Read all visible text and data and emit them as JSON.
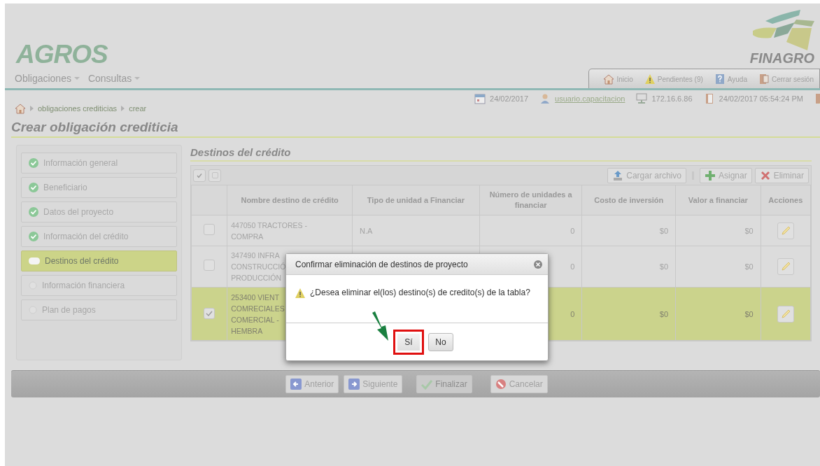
{
  "header": {
    "logo": "AGROS",
    "brand": "FINAGRO",
    "menu": [
      {
        "label": "Obligaciones"
      },
      {
        "label": "Consultas"
      }
    ],
    "top_links": [
      {
        "kind": "home",
        "label": "Inicio"
      },
      {
        "kind": "warning",
        "label": "Pendientes (9)"
      },
      {
        "kind": "help",
        "label": "Ayuda"
      },
      {
        "kind": "exit",
        "label": "Cerrar sesión"
      }
    ]
  },
  "info_bar": [
    {
      "kind": "date",
      "text": "24/02/2017"
    },
    {
      "kind": "user",
      "text": "usuario.capacitacion"
    },
    {
      "kind": "ip",
      "text": "172.16.6.86"
    },
    {
      "kind": "session",
      "text": "24/02/2017 05:54:24 PM"
    },
    {
      "kind": "alert"
    }
  ],
  "breadcrumb": [
    "obligaciones crediticias",
    "crear"
  ],
  "page_title": "Crear obligación crediticia",
  "steps": [
    {
      "label": "Información general",
      "kind": "done",
      "selected": false
    },
    {
      "label": "Beneficiario",
      "kind": "done",
      "selected": false
    },
    {
      "label": "Datos del proyecto",
      "kind": "done",
      "selected": false
    },
    {
      "label": "Información del crédito",
      "kind": "done",
      "selected": false
    },
    {
      "label": "Destinos del crédito",
      "kind": "current",
      "selected": true
    },
    {
      "label": "Información financiera",
      "kind": "pending",
      "selected": false
    },
    {
      "label": "Plan de pagos",
      "kind": "pending",
      "selected": false
    }
  ],
  "section_title": "Destinos del crédito",
  "toolbar_checks": [
    {
      "checked": true
    },
    {
      "checked": false
    }
  ],
  "toolbar": [
    {
      "kind": "upload",
      "label": "Cargar archivo"
    },
    {
      "kind": "add",
      "label": "Asignar"
    },
    {
      "kind": "delete",
      "label": "Eliminar"
    }
  ],
  "table": {
    "columns": [
      "Nombre destino de crédito",
      "Tipo de unidad a Financiar",
      "Número de unidades a financiar",
      "Costo de inversión",
      "Valor a financiar",
      "Acciones"
    ],
    "rows": [
      {
        "selected": false,
        "checked": false,
        "name": "447050 TRACTORES -\nCOMPRA",
        "unit_type": "N.A",
        "units": "0",
        "cost": "$0",
        "value": "$0"
      },
      {
        "selected": false,
        "checked": false,
        "name": "347490 INFRA\nCONSTRUCCIÓ\nPRODUCCIÓN",
        "units": "0",
        "cost": "$0",
        "value": "$0"
      },
      {
        "selected": true,
        "checked": true,
        "name": "253400 VIENT\nCOMRECIALES\nCOMERCIAL -\nHEMBRA",
        "units": "0",
        "cost": "$0",
        "value": "$0"
      }
    ]
  },
  "footer_buttons": [
    {
      "kind": "prev",
      "label": "Anterior",
      "disabled": false
    },
    {
      "kind": "next",
      "label": "Siguiente",
      "disabled": false
    },
    {
      "kind": "finish",
      "label": "Finalizar",
      "disabled": true
    },
    {
      "kind": "cancel",
      "label": "Cancelar",
      "disabled": false
    }
  ],
  "dialog": {
    "title": "Confirmar eliminación de destinos de proyecto",
    "message": "¿Desea eliminar el(los) destino(s) de credito(s) de la tabla?",
    "buttons": [
      {
        "label": "Sí",
        "highlighted": true
      },
      {
        "label": "No",
        "highlighted": false
      }
    ]
  }
}
